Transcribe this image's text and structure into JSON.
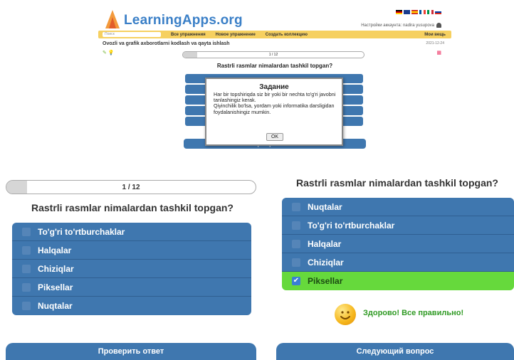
{
  "top": {
    "logo": "LearningApps.org",
    "account_text": "Настройки аккаунта: nadira yusupova",
    "nav": {
      "search_placeholder": "Поиск",
      "all_exercises": "Все упражнения",
      "new_exercise": "Новое упражнение",
      "create_collection": "Создать коллекцию",
      "my_things": "Мои вещь"
    },
    "page_title": "Ovozli va grafik axborotlarni kodlash va qayta ishlash",
    "date": "2021-12-24",
    "progress": "1 / 12",
    "question": "Rastrli rasmlar nimalardan tashkil topgan?",
    "check_button": "Проверить ответ",
    "dialog": {
      "title": "Задание",
      "text1": "Har bir topshiriqda siz bir yoki bir nechta to'g'ri javobni tanlashingiz kerak.",
      "text2": "Qiyinchilik bo'lsa, yordam yoki informatika darsligidan foydalanishingiz mumkin.",
      "ok": "OK"
    }
  },
  "left": {
    "progress": "1 / 12",
    "progress_fraction": 0.08,
    "question": "Rastrli rasmlar nimalardan tashkil topgan?",
    "answers": [
      "To'g'ri to'rtburchaklar",
      "Halqalar",
      "Chiziqlar",
      "Piksellar",
      "Nuqtalar"
    ],
    "check_button": "Проверить ответ"
  },
  "right": {
    "question": "Rastrli rasmlar nimalardan tashkil topgan?",
    "answers": [
      "Nuqtalar",
      "To'g'ri to'rtburchaklar",
      "Halqalar",
      "Chiziqlar",
      "Piksellar"
    ],
    "selected_answer": "Piksellar",
    "success_message": "Здорово! Все правильно!",
    "next_button": "Следующий вопрос"
  },
  "colors": {
    "answer_blue": "#3f77af",
    "correct_green": "#66d93c",
    "logo_blue": "#3a7fc7",
    "nav_yellow": "#f6d060"
  }
}
